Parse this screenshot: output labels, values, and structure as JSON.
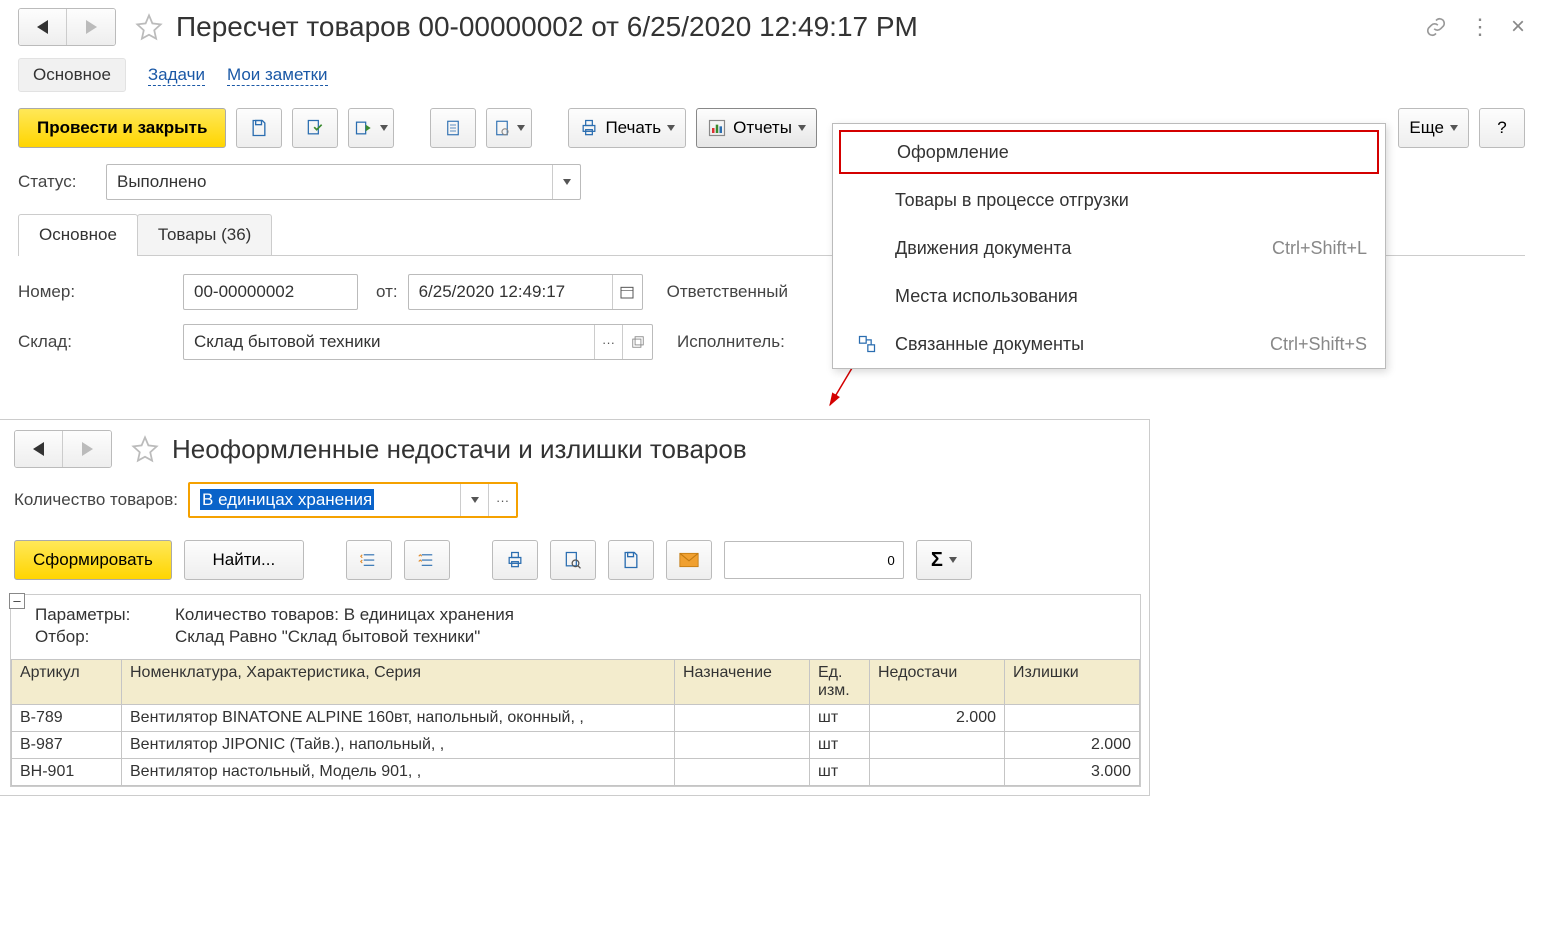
{
  "doc": {
    "title": "Пересчет товаров 00-00000002 от 6/25/2020 12:49:17 PM"
  },
  "viewTabs": {
    "main": "Основное",
    "tasks": "Задачи",
    "notes": "Мои заметки"
  },
  "toolbar": {
    "postAndClose": "Провести и закрыть",
    "print": "Печать",
    "reports": "Отчеты",
    "more": "Еще",
    "help": "?"
  },
  "dropdown": {
    "items": [
      {
        "label": "Оформление",
        "shortcut": "",
        "highlight": true
      },
      {
        "label": "Товары в процессе отгрузки",
        "shortcut": ""
      },
      {
        "label": "Движения документа",
        "shortcut": "Ctrl+Shift+L"
      },
      {
        "label": "Места использования",
        "shortcut": ""
      },
      {
        "label": "Связанные документы",
        "shortcut": "Ctrl+Shift+S"
      }
    ]
  },
  "form": {
    "statusLabel": "Статус:",
    "statusValue": "Выполнено",
    "pageTabMain": "Основное",
    "pageTabGoods": "Товары (36)",
    "numberLabel": "Номер:",
    "numberValue": "00-00000002",
    "atLabel": "от:",
    "dateValue": "6/25/2020 12:49:17",
    "responsibleLabel": "Ответственный",
    "warehouseLabel": "Склад:",
    "warehouseValue": "Склад бытовой техники",
    "executorLabel": "Исполнитель:"
  },
  "sub": {
    "title": "Неоформленные недостачи и излишки товаров",
    "qtyLabel": "Количество товаров:",
    "qtyValue": "В единицах хранения",
    "generate": "Сформировать",
    "find": "Найти...",
    "numField": "0"
  },
  "report": {
    "paramsLabel": "Параметры:",
    "paramsValue": "Количество товаров: В единицах хранения",
    "filterLabel": "Отбор:",
    "filterValue": "Склад Равно \"Склад бытовой техники\"",
    "headers": {
      "article": "Артикул",
      "nomenclature": "Номенклатура, Характеристика, Серия",
      "destination": "Назначение",
      "unit": "Ед. изм.",
      "shortage": "Недостачи",
      "surplus": "Излишки"
    },
    "rows": [
      {
        "art": "В-789",
        "nom": "Вентилятор BINATONE ALPINE 160вт, напольный, оконный, ,",
        "dest": "",
        "unit": "шт",
        "short": "2.000",
        "surp": ""
      },
      {
        "art": "В-987",
        "nom": "Вентилятор JIPONIC (Тайв.), напольный, ,",
        "dest": "",
        "unit": "шт",
        "short": "",
        "surp": "2.000"
      },
      {
        "art": "ВН-901",
        "nom": "Вентилятор настольный, Модель 901, ,",
        "dest": "",
        "unit": "шт",
        "short": "",
        "surp": "3.000"
      }
    ]
  }
}
